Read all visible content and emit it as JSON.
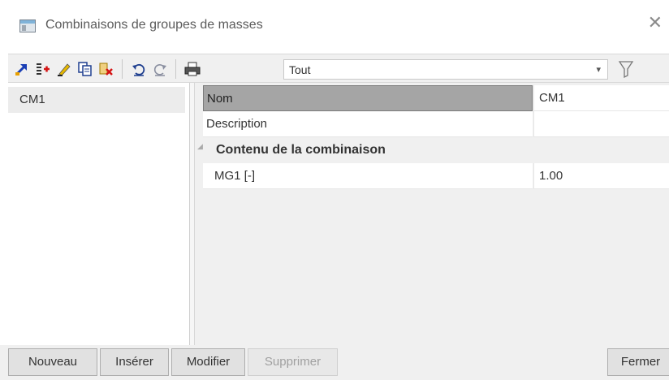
{
  "window": {
    "title": "Combinaisons de groupes de masses",
    "icon": "window-app-icon"
  },
  "toolbar": {
    "icons": [
      "new-arrow-icon",
      "insert-rows-icon",
      "edit-pencil-icon",
      "copy-icon",
      "delete-icon",
      "undo-icon",
      "redo-icon",
      "print-icon"
    ],
    "filter_value": "Tout",
    "filter_icon": "funnel-icon"
  },
  "list": {
    "items": [
      {
        "label": "CM1",
        "selected": true
      }
    ]
  },
  "grid": {
    "rows": [
      {
        "name": "Nom",
        "value": "CM1"
      },
      {
        "name": "Description",
        "value": ""
      }
    ],
    "category": {
      "label": "Contenu de la combinaison"
    },
    "category_rows": [
      {
        "name": "MG1 [-]",
        "value": "1.00"
      }
    ]
  },
  "buttons": {
    "new": "Nouveau",
    "insert": "Insérer",
    "modify": "Modifier",
    "delete": "Supprimer",
    "close": "Fermer"
  },
  "colors": {
    "selected_cell": "#a5a5a5",
    "window_bg": "#f0f0f0"
  }
}
